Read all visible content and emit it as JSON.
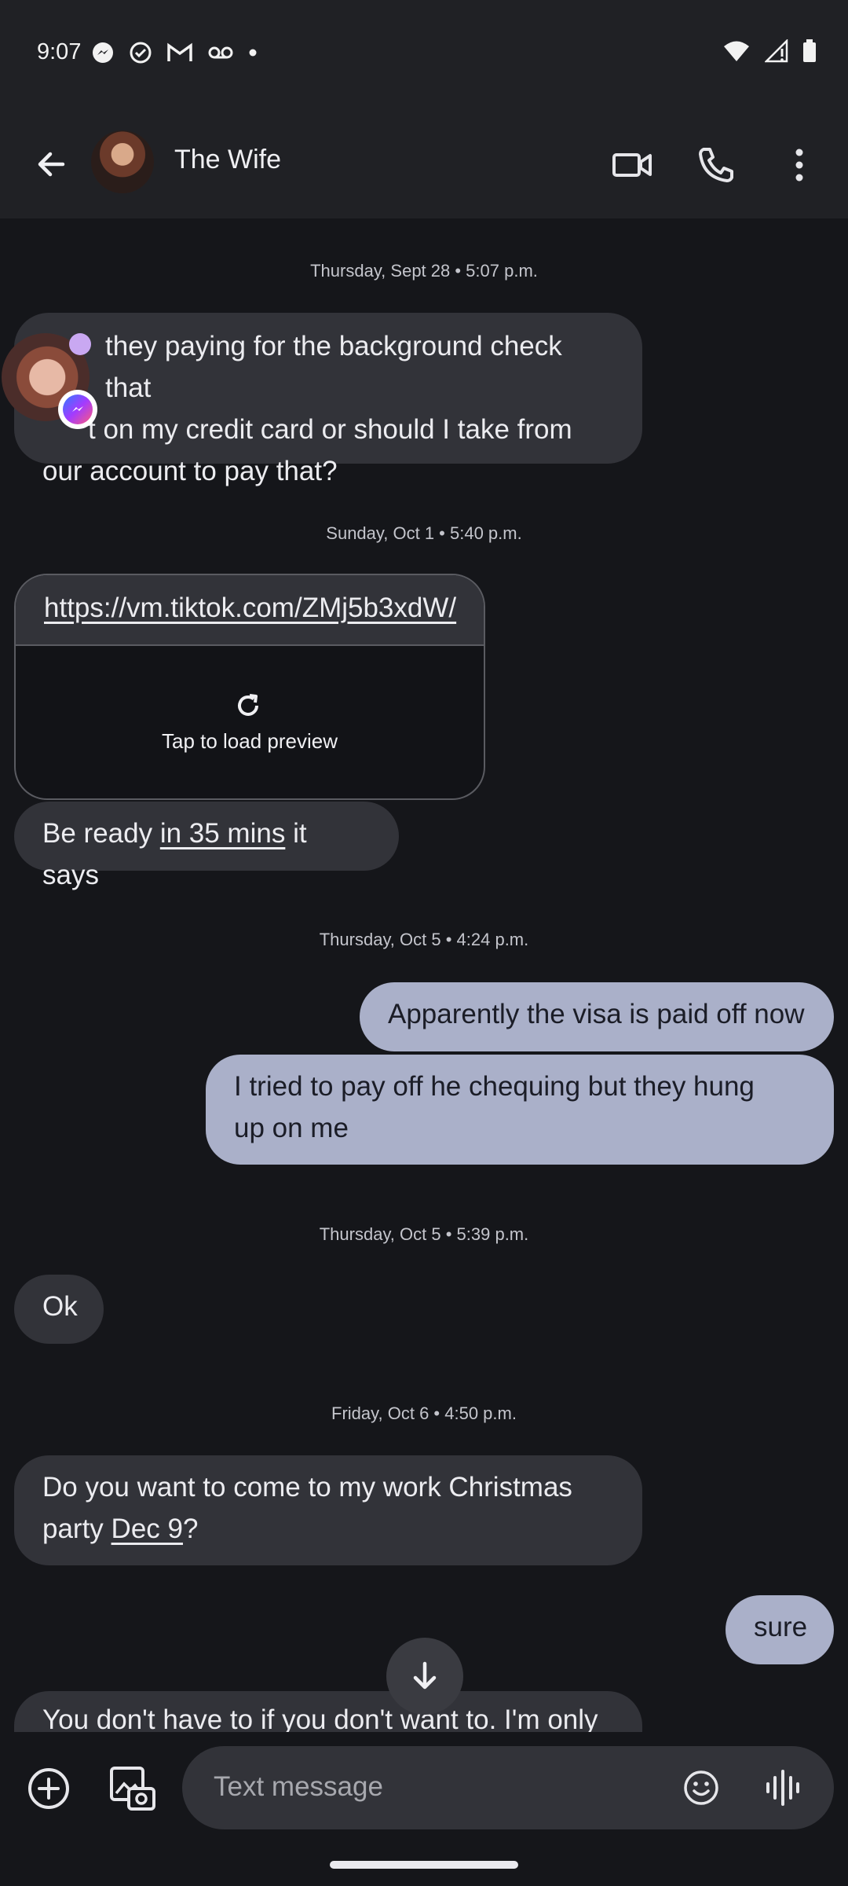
{
  "status": {
    "time": "9:07",
    "icons_left": [
      "messenger-icon",
      "check-circle-icon",
      "gmail-icon",
      "voicemail-icon",
      "dot-icon"
    ],
    "icons_right": [
      "wifi-icon",
      "signal-icon",
      "battery-icon"
    ]
  },
  "header": {
    "title": "The Wife",
    "actions": [
      "video-call-icon",
      "phone-icon",
      "more-vert-icon"
    ]
  },
  "messages": [
    {
      "date": "Thursday, Sept 28 • 5:07 p.m."
    },
    {
      "from": "them",
      "lines": [
        "they paying for the background check that",
        "t on my credit card or should I take from",
        "our account to pay that?"
      ]
    },
    {
      "date": "Sunday, Oct 1 • 5:40 p.m."
    },
    {
      "from": "them",
      "link": "https://vm.tiktok.com/ZMj5b3xdW/",
      "preview": "Tap to load preview"
    },
    {
      "from": "them",
      "text_before": "Be ready ",
      "text_link": "in 35 mins",
      "text_after": " it says"
    },
    {
      "date": "Thursday, Oct 5 • 4:24 p.m."
    },
    {
      "from": "me",
      "text": "Apparently the visa is paid off now"
    },
    {
      "from": "me",
      "lines": [
        "I tried to pay off he chequing  but they  hung",
        "up on me"
      ]
    },
    {
      "date": "Thursday, Oct 5 • 5:39 p.m."
    },
    {
      "from": "them",
      "text": "Ok"
    },
    {
      "date": "Friday, Oct 6 • 4:50 p.m."
    },
    {
      "from": "them",
      "line1": "Do you want to come to my work Christmas",
      "line2_before": "party ",
      "line2_link": "Dec 9",
      "line2_after": "?"
    },
    {
      "from": "me",
      "text": "sure"
    },
    {
      "from": "them",
      "text": "You don't have to if you don't want to. I'm only"
    }
  ],
  "composer": {
    "placeholder": "Text message"
  }
}
